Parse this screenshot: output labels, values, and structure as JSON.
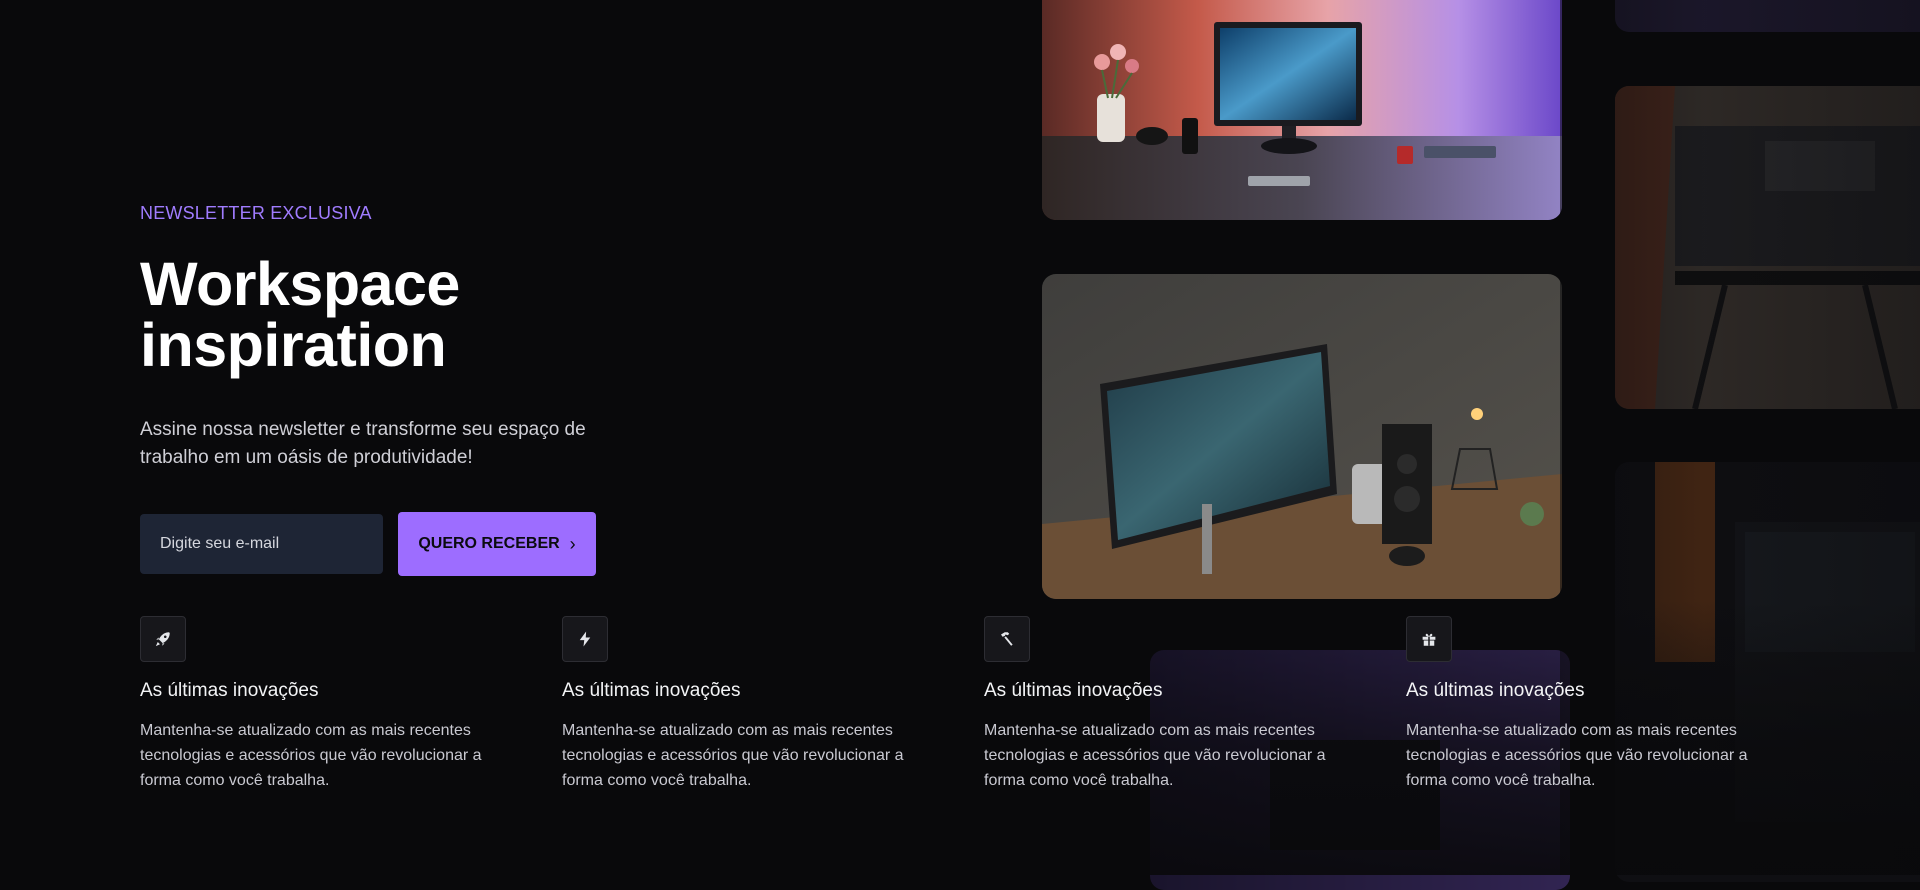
{
  "hero": {
    "eyebrow": "NEWSLETTER EXCLUSIVA",
    "title": "Workspace inspiration",
    "subtitle": "Assine nossa newsletter e transforme seu espaço de trabalho em um oásis de produtividade!",
    "email_placeholder": "Digite seu e-mail",
    "cta_label": "QUERO RECEBER",
    "cta_icon": "chevron-right-icon"
  },
  "features": [
    {
      "icon": "rocket-icon",
      "title": "As últimas inovações",
      "description": "Mantenha-se atualizado com as mais recentes tecnologias e acessórios que vão revolucionar a forma como você trabalha."
    },
    {
      "icon": "lightning-icon",
      "title": "As últimas inovações",
      "description": "Mantenha-se atualizado com as mais recentes tecnologias e acessórios que vão revolucionar a forma como você trabalha."
    },
    {
      "icon": "hammer-icon",
      "title": "As últimas inovações",
      "description": "Mantenha-se atualizado com as mais recentes tecnologias e acessórios que vão revolucionar a forma como você trabalha."
    },
    {
      "icon": "gift-icon",
      "title": "As últimas inovações",
      "description": "Mantenha-se atualizado com as mais recentes tecnologias e acessórios que vão revolucionar a forma como você trabalha."
    }
  ],
  "colors": {
    "background": "#09090b",
    "accent": "#9d6dff",
    "eyebrow": "#a07cff",
    "input_bg": "#1e2535"
  },
  "gallery": {
    "images": [
      "desk-setup-photo",
      "monitor-desk-photo",
      "dark-desk-photo",
      "dark-studio-photo",
      "purple-room-photo"
    ]
  }
}
